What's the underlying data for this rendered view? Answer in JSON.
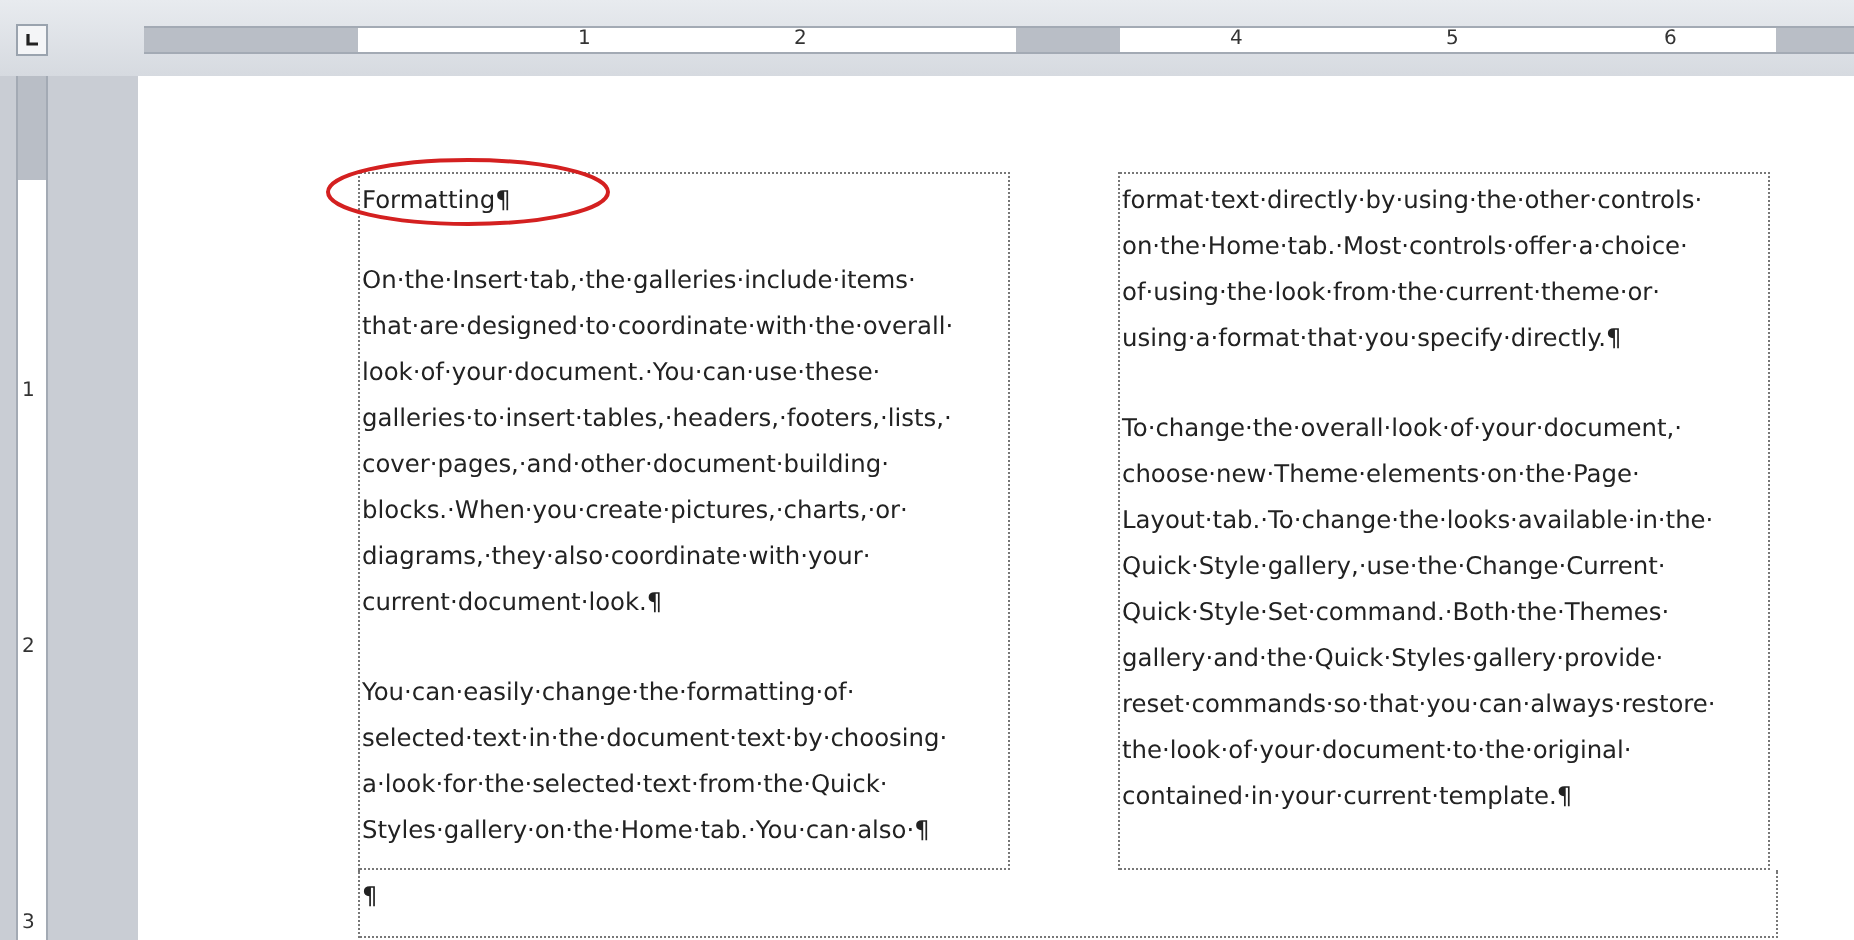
{
  "horizontal_ruler": {
    "numbers": [
      "1",
      "2",
      "4",
      "5",
      "6"
    ]
  },
  "vertical_ruler": {
    "numbers": [
      "1",
      "2",
      "3"
    ]
  },
  "document": {
    "columns": [
      {
        "paragraphs": [
          {
            "kind": "heading",
            "lines": [
              "Formatting¶"
            ]
          },
          {
            "kind": "body",
            "lines": [
              "On·the·Insert·tab,·the·galleries·include·items·",
              "that·are·designed·to·coordinate·with·the·overall·",
              "look·of·your·document.·You·can·use·these·",
              "galleries·to·insert·tables,·headers,·footers,·lists,·",
              "cover·pages,·and·other·document·building·",
              "blocks.·When·you·create·pictures,·charts,·or·",
              "diagrams,·they·also·coordinate·with·your·",
              "current·document·look.¶"
            ]
          },
          {
            "kind": "body",
            "lines": [
              "You·can·easily·change·the·formatting·of·",
              "selected·text·in·the·document·text·by·choosing·",
              "a·look·for·the·selected·text·from·the·Quick·",
              "Styles·gallery·on·the·Home·tab.·You·can·also·¶"
            ]
          }
        ]
      },
      {
        "paragraphs": [
          {
            "kind": "body",
            "lines": [
              "format·text·directly·by·using·the·other·controls·",
              "on·the·Home·tab.·Most·controls·offer·a·choice·",
              "of·using·the·look·from·the·current·theme·or·",
              "using·a·format·that·you·specify·directly.¶"
            ]
          },
          {
            "kind": "break",
            "lines": [
              "To·change·the·overall·look·of·your·document,·",
              "choose·new·Theme·elements·on·the·Page·",
              "Layout·tab.·To·change·the·looks·available·in·the·",
              "Quick·Style·gallery,·use·the·Change·Current·",
              "Quick·Style·Set·command.·Both·the·Themes·",
              "gallery·and·the·Quick·Styles·gallery·provide·",
              "reset·commands·so·that·you·can·always·restore·",
              "the·look·of·your·document·to·the·original·",
              "contained·in·your·current·template.¶"
            ]
          }
        ]
      }
    ],
    "after_table": "¶"
  }
}
